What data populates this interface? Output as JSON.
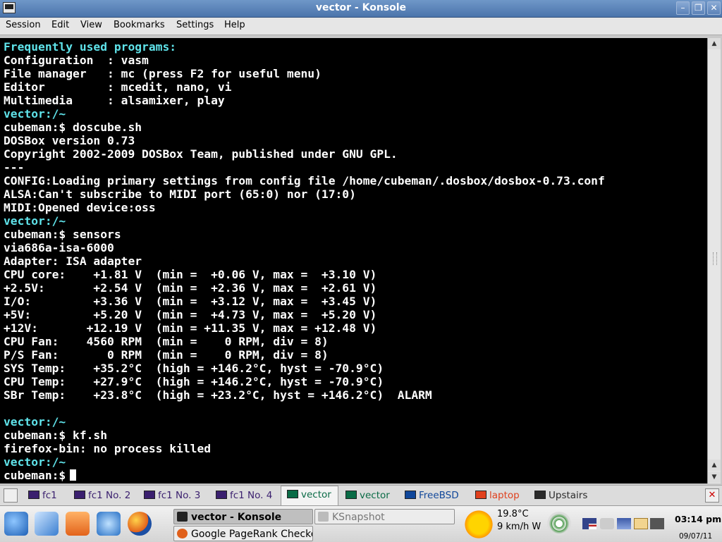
{
  "window": {
    "title": "vector - Konsole"
  },
  "menu": [
    "Session",
    "Edit",
    "View",
    "Bookmarks",
    "Settings",
    "Help"
  ],
  "terminal": {
    "lines": [
      {
        "text": "Frequently used programs:",
        "color": "cyan"
      },
      {
        "text": "Configuration  : vasm",
        "color": "white"
      },
      {
        "text": "File manager   : mc (press F2 for useful menu)",
        "color": "white"
      },
      {
        "text": "Editor         : mcedit, nano, vi",
        "color": "white"
      },
      {
        "text": "Multimedia     : alsamixer, play",
        "color": "white"
      },
      {
        "text": "vector:/~",
        "color": "cyan"
      },
      {
        "text": "cubeman:$ doscube.sh",
        "color": "white"
      },
      {
        "text": "DOSBox version 0.73",
        "color": "white"
      },
      {
        "text": "Copyright 2002-2009 DOSBox Team, published under GNU GPL.",
        "color": "white"
      },
      {
        "text": "---",
        "color": "white"
      },
      {
        "text": "CONFIG:Loading primary settings from config file /home/cubeman/.dosbox/dosbox-0.73.conf",
        "color": "white"
      },
      {
        "text": "ALSA:Can't subscribe to MIDI port (65:0) nor (17:0)",
        "color": "white"
      },
      {
        "text": "MIDI:Opened device:oss",
        "color": "white"
      },
      {
        "text": "vector:/~",
        "color": "cyan"
      },
      {
        "text": "cubeman:$ sensors",
        "color": "white"
      },
      {
        "text": "via686a-isa-6000",
        "color": "white"
      },
      {
        "text": "Adapter: ISA adapter",
        "color": "white"
      },
      {
        "text": "CPU core:    +1.81 V  (min =  +0.06 V, max =  +3.10 V)",
        "color": "white"
      },
      {
        "text": "+2.5V:       +2.54 V  (min =  +2.36 V, max =  +2.61 V)",
        "color": "white"
      },
      {
        "text": "I/O:         +3.36 V  (min =  +3.12 V, max =  +3.45 V)",
        "color": "white"
      },
      {
        "text": "+5V:         +5.20 V  (min =  +4.73 V, max =  +5.20 V)",
        "color": "white"
      },
      {
        "text": "+12V:       +12.19 V  (min = +11.35 V, max = +12.48 V)",
        "color": "white"
      },
      {
        "text": "CPU Fan:    4560 RPM  (min =    0 RPM, div = 8)",
        "color": "white"
      },
      {
        "text": "P/S Fan:       0 RPM  (min =    0 RPM, div = 8)",
        "color": "white"
      },
      {
        "text": "SYS Temp:    +35.2°C  (high = +146.2°C, hyst = -70.9°C)",
        "color": "white"
      },
      {
        "text": "CPU Temp:    +27.9°C  (high = +146.2°C, hyst = -70.9°C)",
        "color": "white"
      },
      {
        "text": "SBr Temp:    +23.8°C  (high = +23.2°C, hyst = +146.2°C)  ALARM",
        "color": "white"
      },
      {
        "text": "",
        "color": "white"
      },
      {
        "text": "vector:/~",
        "color": "cyan"
      },
      {
        "text": "cubeman:$ kf.sh",
        "color": "white"
      },
      {
        "text": "firefox-bin: no process killed",
        "color": "white"
      },
      {
        "text": "vector:/~",
        "color": "cyan"
      }
    ],
    "prompt": "cubeman:$"
  },
  "tabs": [
    {
      "label": "fc1",
      "icon": "terminal-icon",
      "color": "#3a1f6e"
    },
    {
      "label": "fc1 No. 2",
      "icon": "terminal-icon",
      "color": "#3a1f6e"
    },
    {
      "label": "fc1 No. 3",
      "icon": "terminal-icon",
      "color": "#3a1f6e"
    },
    {
      "label": "fc1 No. 4",
      "icon": "terminal-icon",
      "color": "#3a1f6e"
    },
    {
      "label": "vector",
      "icon": "terminal-icon",
      "color": "#0a6b46",
      "active": true
    },
    {
      "label": "vector",
      "icon": "terminal-icon",
      "color": "#0a6b46"
    },
    {
      "label": "FreeBSD",
      "icon": "terminal-icon",
      "color": "#10479a"
    },
    {
      "label": "laptop",
      "icon": "laptop-icon",
      "color": "#e0401d"
    },
    {
      "label": "Upstairs",
      "icon": "bitcoin-icon",
      "color": "#2b2b2b"
    }
  ],
  "taskbar": {
    "tasks": [
      "vector - Konsole",
      "KSnapshot",
      "Google PageRank Checker"
    ],
    "weather": {
      "temp": "19.8°C",
      "wind": "9 km/h W"
    },
    "clock": "03:14 pm",
    "date": "09/07/11"
  }
}
